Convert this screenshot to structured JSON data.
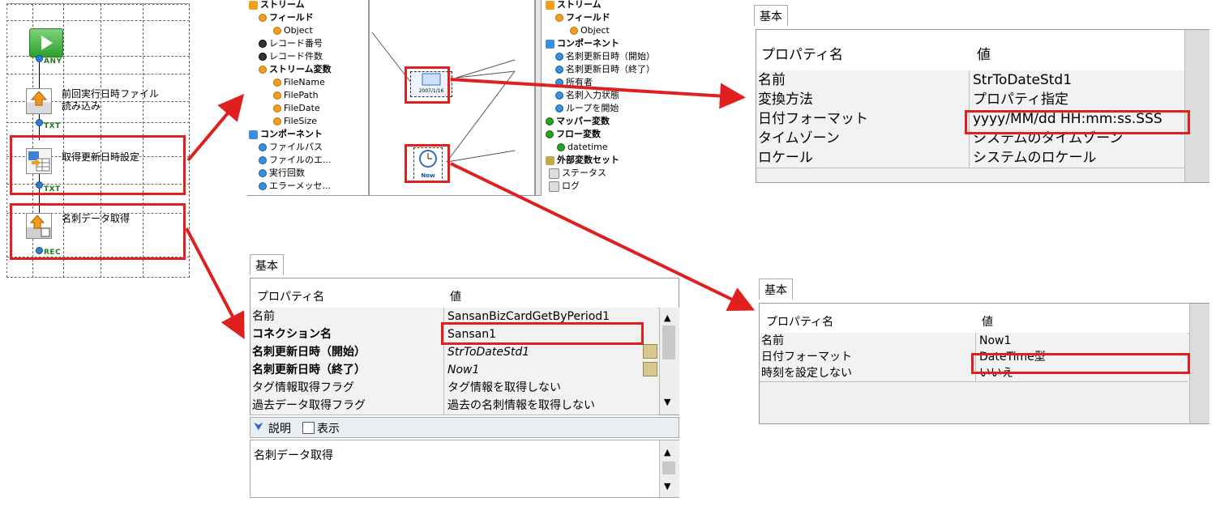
{
  "flow": {
    "links": {
      "any": "ANY",
      "txt1": "TXT",
      "txt2": "TXT",
      "rec": "REC"
    },
    "nodes": {
      "read_file_line1": "前回実行日時ファイル",
      "read_file_line2": "読み込み",
      "set_update": "取得更新日時設定",
      "get_card": "名刺データ取得"
    }
  },
  "mapper": {
    "left_tree": {
      "stream": "ストリーム",
      "field": "フィールド",
      "object": "Object",
      "record_no": "レコード番号",
      "record_count": "レコード件数",
      "stream_var": "ストリーム変数",
      "filename": "FileName",
      "filepath": "FilePath",
      "filedate": "FileDate",
      "filesize": "FileSize",
      "component": "コンポーネント",
      "file_path": "ファイルパス",
      "file_e": "ファイルのエ...",
      "exec_count": "実行回数",
      "error_msg": "エラーメッセ..."
    },
    "canvas": {
      "date_icon": "2007/1/16",
      "now_icon": "Now"
    },
    "right_tree": {
      "stream": "ストリーム",
      "field": "フィールド",
      "object": "Object",
      "component": "コンポーネント",
      "card_update_start": "名刺更新日時（開始）",
      "card_update_end": "名刺更新日時（終了）",
      "owner": "所有者",
      "card_input_state": "名刺入力状態",
      "loop_start": "ループを開始",
      "mapper_var": "マッパー変数",
      "flow_var": "フロー変数",
      "datetime": "datetime",
      "ext_var_set": "外部変数セット",
      "status": "ステータス",
      "log": "ログ"
    }
  },
  "panel_strtodate": {
    "tab": "基本",
    "header": {
      "name": "プロパティ名",
      "value": "値"
    },
    "rows": [
      {
        "name": "名前",
        "value": "StrToDateStd1"
      },
      {
        "name": "変換方法",
        "value": "プロパティ指定"
      },
      {
        "name": "日付フォーマット",
        "value": "yyyy/MM/dd HH:mm:ss.SSS"
      },
      {
        "name": "タイムゾーン",
        "value": "システムのタイムゾーン"
      },
      {
        "name": "ロケール",
        "value": "システムのロケール"
      }
    ]
  },
  "panel_sansan": {
    "tab": "基本",
    "header": {
      "name": "プロパティ名",
      "value": "値"
    },
    "rows": [
      {
        "name": "名前",
        "value": "SansanBizCardGetByPeriod1"
      },
      {
        "name": "コネクション名",
        "value": "Sansan1"
      },
      {
        "name": "名刺更新日時（開始）",
        "value": "StrToDateStd1"
      },
      {
        "name": "名刺更新日時（終了）",
        "value": "Now1"
      },
      {
        "name": "タグ情報取得フラグ",
        "value": "タグ情報を取得しない"
      },
      {
        "name": "過去データ取得フラグ",
        "value": "過去の名刺情報を取得しない"
      }
    ],
    "description_label": "説明",
    "show_label": "表示",
    "description_text": "名刺データ取得"
  },
  "panel_now": {
    "tab": "基本",
    "header": {
      "name": "プロパティ名",
      "value": "値"
    },
    "rows": [
      {
        "name": "名前",
        "value": "Now1"
      },
      {
        "name": "日付フォーマット",
        "value": "DateTime型"
      },
      {
        "name": "時刻を設定しない",
        "value": "いいえ"
      }
    ]
  },
  "colors": {
    "highlight": "#e01f1f",
    "arrow": "#e01f1f"
  }
}
